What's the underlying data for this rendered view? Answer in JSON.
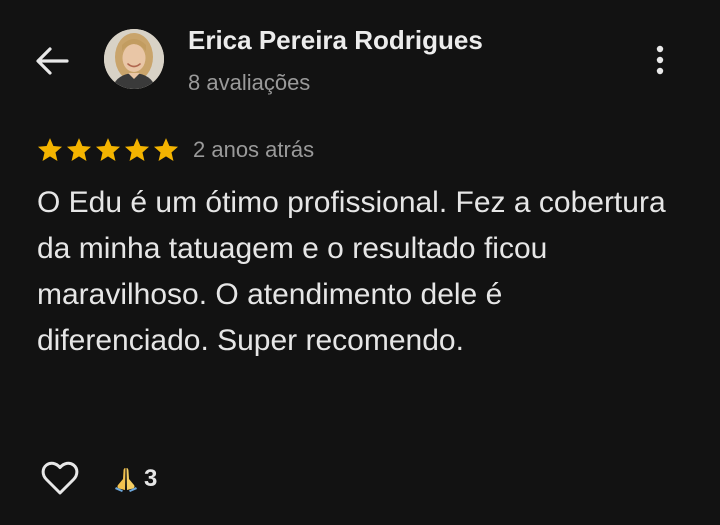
{
  "review": {
    "author": {
      "name": "Erica Pereira Rodrigues",
      "reviews_count": "8 avaliações"
    },
    "rating": 5,
    "time_ago": "2 anos atrás",
    "text": "O Edu é um ótimo profissional. Fez a cobertura da minha tatuagem e o resultado ficou maravilhoso. O atendimento dele é diferenciado. Super recomendo.",
    "reactions": {
      "praying_hands_count": "3"
    }
  },
  "colors": {
    "background": "#121212",
    "star": "#F4B400",
    "primary_text": "#ECECEC",
    "secondary_text": "#9A9A9A"
  },
  "icons": {
    "back": "arrow-left-icon",
    "more": "more-vertical-icon",
    "star": "star-icon",
    "like": "heart-outline-icon",
    "reaction": "praying-hands-icon"
  }
}
